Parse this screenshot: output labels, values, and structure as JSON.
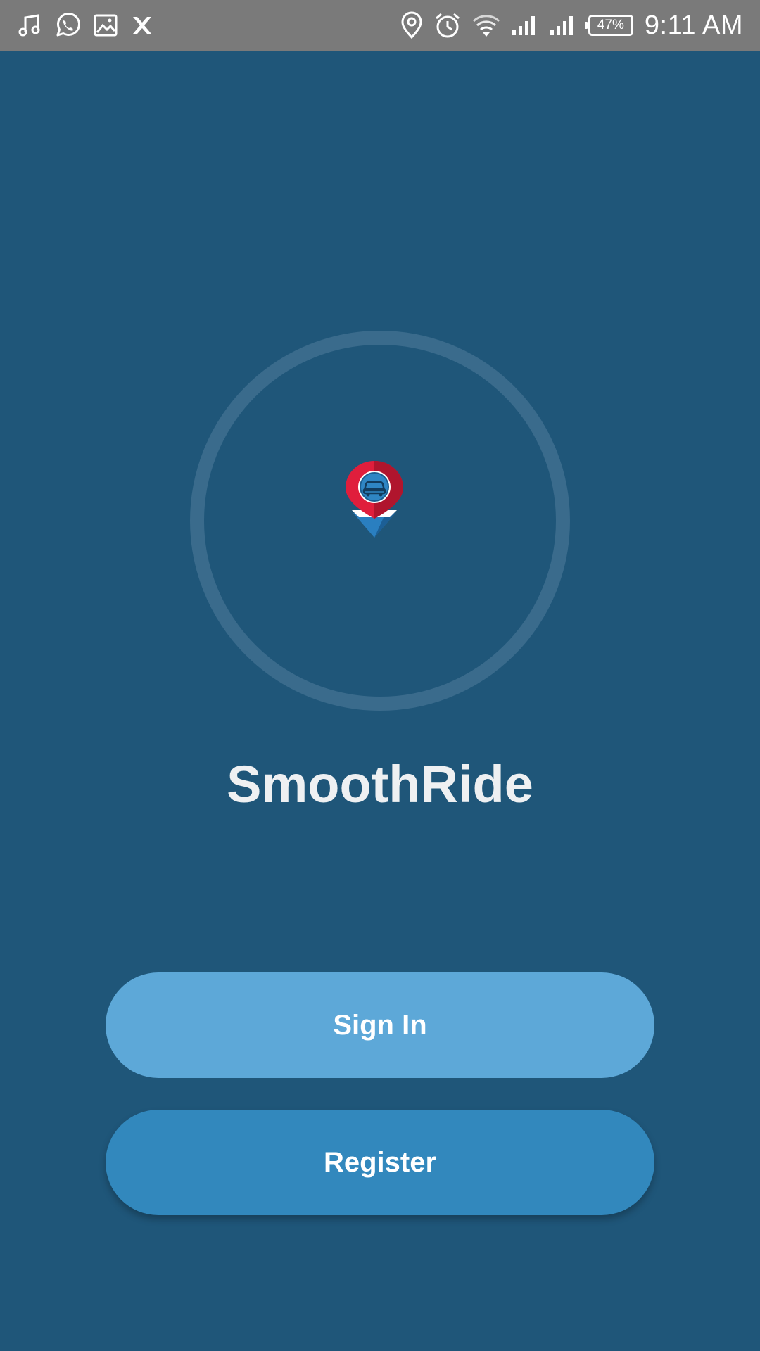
{
  "status_bar": {
    "left_icons": [
      "music-note-icon",
      "whatsapp-icon",
      "gallery-icon",
      "x-app-icon"
    ],
    "right_icons": [
      "location-icon",
      "alarm-icon",
      "wifi-icon",
      "signal-icon",
      "signal-icon-2"
    ],
    "battery": "47%",
    "time": "9:11 AM"
  },
  "app": {
    "name": "SmoothRide",
    "logo_icon": "car-location-pin-icon"
  },
  "buttons": {
    "sign_in": "Sign In",
    "register": "Register"
  },
  "colors": {
    "background": "#1f5679",
    "status_bar": "#7a7a7a",
    "sign_in_button": "#5da8d8",
    "register_button": "#3288bd",
    "ring": "#3a6b8c",
    "pin_red": "#e01e3c"
  }
}
